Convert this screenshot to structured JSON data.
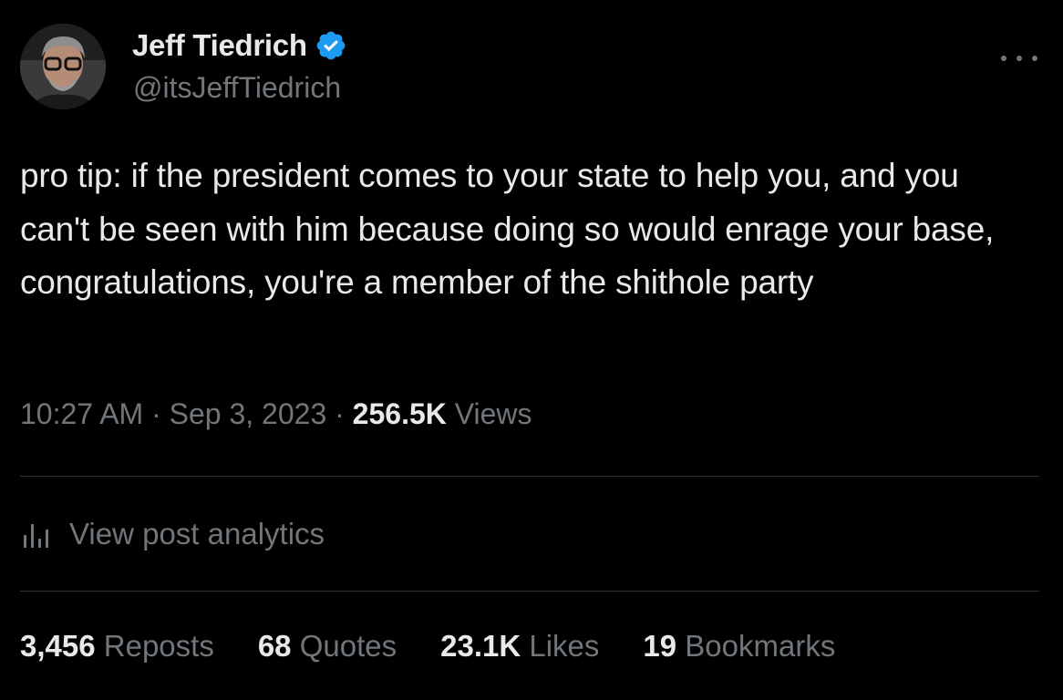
{
  "author": {
    "display_name": "Jeff Tiedrich",
    "handle": "@itsJeffTiedrich",
    "verified": true,
    "verified_color": "#1d9bf0"
  },
  "tweet": {
    "text": "pro tip: if the president comes to your state to help you, and you can't be seen with him because doing so would enrage your base, congratulations, you're a member of the shithole party"
  },
  "meta": {
    "time": "10:27 AM",
    "separator": "·",
    "date": "Sep 3, 2023",
    "views_count": "256.5K",
    "views_label": "Views"
  },
  "analytics": {
    "label": "View post analytics",
    "icon": "analytics-bars-icon"
  },
  "stats": [
    {
      "count": "3,456",
      "label": "Reposts"
    },
    {
      "count": "68",
      "label": "Quotes"
    },
    {
      "count": "23.1K",
      "label": "Likes"
    },
    {
      "count": "19",
      "label": "Bookmarks"
    }
  ],
  "colors": {
    "background": "#000000",
    "text_primary": "#e7e9ea",
    "text_secondary": "#71767b",
    "divider": "#2f3336"
  }
}
